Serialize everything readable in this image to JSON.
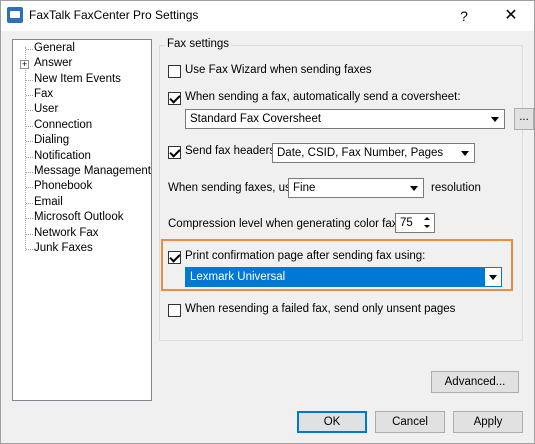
{
  "window": {
    "title": "FaxTalk FaxCenter Pro Settings",
    "help_glyph": "?",
    "close_glyph": "✕"
  },
  "nav": {
    "items": [
      {
        "label": "General",
        "expandable": false
      },
      {
        "label": "Answer",
        "expandable": true
      },
      {
        "label": "New Item Events",
        "expandable": false
      },
      {
        "label": "Fax",
        "expandable": false
      },
      {
        "label": "User",
        "expandable": false
      },
      {
        "label": "Connection",
        "expandable": false
      },
      {
        "label": "Dialing",
        "expandable": false
      },
      {
        "label": "Notification",
        "expandable": false
      },
      {
        "label": "Message Management",
        "expandable": false
      },
      {
        "label": "Phonebook",
        "expandable": false
      },
      {
        "label": "Email",
        "expandable": false
      },
      {
        "label": "Microsoft Outlook",
        "expandable": false
      },
      {
        "label": "Network Fax",
        "expandable": false
      },
      {
        "label": "Junk Faxes",
        "expandable": false
      }
    ],
    "expander_glyph": "+"
  },
  "fax_settings": {
    "group_label": "Fax settings",
    "use_fax_wizard": {
      "label": "Use Fax Wizard when sending faxes",
      "checked": false
    },
    "send_coversheet": {
      "label": "When sending a fax, automatically send a coversheet:",
      "checked": true
    },
    "coversheet_select": {
      "value": "Standard Fax Coversheet"
    },
    "browse_button": {
      "label": "..."
    },
    "send_fax_headers": {
      "label": "Send fax headers:",
      "checked": true
    },
    "headers_select": {
      "value": "Date, CSID, Fax Number, Pages"
    },
    "resolution_prefix": "When sending faxes, use",
    "resolution_select": {
      "value": "Fine"
    },
    "resolution_suffix": "resolution",
    "compression_label": "Compression level when generating color faxes:",
    "compression_value": "75",
    "print_confirmation": {
      "label": "Print confirmation page after sending fax using:",
      "checked": true
    },
    "printer_select": {
      "value": "Lexmark Universal"
    },
    "resend_unsent": {
      "label": "When resending a failed fax, send only unsent pages",
      "checked": false
    }
  },
  "buttons": {
    "advanced": "Advanced...",
    "ok": "OK",
    "cancel": "Cancel",
    "apply": "Apply"
  },
  "colors": {
    "highlight_border": "#f08a3c",
    "selection": "#0078d7"
  }
}
